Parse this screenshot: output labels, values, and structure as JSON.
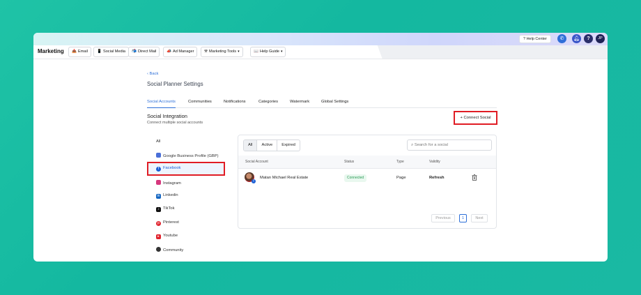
{
  "topbar": {
    "help_center": "? Help Center",
    "avatar_initials": "JP"
  },
  "menubar": {
    "app_title": "Marketing",
    "items": [
      {
        "icon": "📤",
        "label": "Email"
      },
      {
        "icon": "📱",
        "label": "Social Media"
      },
      {
        "icon": "📬",
        "label": "Direct Mail"
      },
      {
        "icon": "📣",
        "label": "Ad Manager"
      },
      {
        "icon": "⚒",
        "label": "Marketing Tools"
      },
      {
        "icon": "📖",
        "label": "Help Guide"
      }
    ]
  },
  "page": {
    "back_label": "Back",
    "title": "Social Planner Settings"
  },
  "tabs": [
    {
      "label": "Social Accounts",
      "active": true
    },
    {
      "label": "Communities",
      "active": false
    },
    {
      "label": "Notifications",
      "active": false
    },
    {
      "label": "Categories",
      "active": false
    },
    {
      "label": "Watermark",
      "active": false
    },
    {
      "label": "Global Settings",
      "active": false
    }
  ],
  "section": {
    "title": "Social Integration",
    "subtitle": "Connect multiple social accounts",
    "connect_button": "Connect Social"
  },
  "social_list": [
    {
      "label": "All",
      "icon": ""
    },
    {
      "label": "Google Business Profile (GBP)",
      "icon": "gbp-icon",
      "color": "#4a6fd8"
    },
    {
      "label": "Facebook",
      "icon": "facebook-icon",
      "color": "#1a5fd6",
      "selected": true
    },
    {
      "label": "Instagram",
      "icon": "instagram-icon",
      "color": "#d6377d"
    },
    {
      "label": "Linkedin",
      "icon": "linkedin-icon",
      "color": "#1466c2"
    },
    {
      "label": "TikTok",
      "icon": "tiktok-icon",
      "color": "#111111"
    },
    {
      "label": "Pinterest",
      "icon": "pinterest-icon",
      "color": "#e0232d"
    },
    {
      "label": "Youtube",
      "icon": "youtube-icon",
      "color": "#e0232d"
    },
    {
      "label": "Community",
      "icon": "community-icon",
      "color": "#333333"
    }
  ],
  "filter": {
    "segments": [
      "All",
      "Active",
      "Expired"
    ],
    "active_segment": "All",
    "search_placeholder": "Search for a social"
  },
  "table": {
    "headers": [
      "Social Account",
      "Status",
      "Type",
      "Validity"
    ],
    "rows": [
      {
        "account": "Matan Michael Real Estate",
        "status": "Connected",
        "type": "Page",
        "validity": "Refresh"
      }
    ]
  },
  "pagination": {
    "previous": "Previous",
    "page": "1",
    "next": "Next"
  }
}
